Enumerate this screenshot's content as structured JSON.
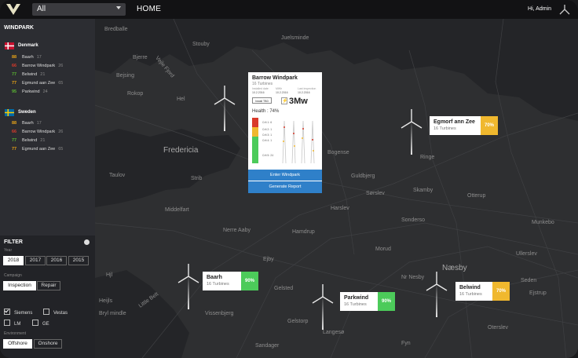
{
  "topbar": {
    "select_value": "All",
    "home_label": "HOME",
    "user_label": "Hi, Admin"
  },
  "sidebar": {
    "title": "WINDPARK",
    "countries": [
      {
        "name": "Denmark",
        "parks": [
          {
            "score": "88",
            "name": "Baarh",
            "count": "17",
            "color": "#e8a317"
          },
          {
            "score": "66",
            "name": "Barrow Windpark",
            "count": "26",
            "color": "#d93a2b"
          },
          {
            "score": "77",
            "name": "Belwind",
            "count": "21",
            "color": "#5bb832"
          },
          {
            "score": "77",
            "name": "Egmund aan Zee",
            "count": "65",
            "color": "#e8a317"
          },
          {
            "score": "95",
            "name": "Parkwind",
            "count": "24",
            "color": "#5bb832"
          }
        ]
      },
      {
        "name": "Sweden",
        "parks": [
          {
            "score": "88",
            "name": "Baarh",
            "count": "17",
            "color": "#e8a317"
          },
          {
            "score": "66",
            "name": "Barrow Windpark",
            "count": "26",
            "color": "#d93a2b"
          },
          {
            "score": "77",
            "name": "Belwind",
            "count": "21",
            "color": "#5bb832"
          },
          {
            "score": "77",
            "name": "Egmund aan Zee",
            "count": "65",
            "color": "#e8a317"
          }
        ]
      }
    ]
  },
  "filter": {
    "title": "FILTER",
    "year_label": "Year",
    "years": [
      "2018",
      "2017",
      "2016",
      "2015"
    ],
    "campaign_label": "Campaign",
    "campaigns": [
      "Inspection",
      "Repair"
    ],
    "makers": [
      {
        "label": "Siemens",
        "checked": true
      },
      {
        "label": "Vestas",
        "checked": false
      },
      {
        "label": "LM",
        "checked": false
      },
      {
        "label": "GE",
        "checked": false
      }
    ],
    "environment_label": "Environment",
    "environments": [
      "Offshore",
      "Onshore"
    ]
  },
  "map": {
    "cities": [
      {
        "name": "Bredballe",
        "big": false
      },
      {
        "name": "Stouby",
        "big": false
      },
      {
        "name": "Juelsminde",
        "big": false
      },
      {
        "name": "Bjerre",
        "big": false
      },
      {
        "name": "Vejle Fjord",
        "big": false
      },
      {
        "name": "Bejsing",
        "big": false
      },
      {
        "name": "Rokop",
        "big": false
      },
      {
        "name": "Hel",
        "big": false
      },
      {
        "name": "Fredericia",
        "big": true
      },
      {
        "name": "Taulov",
        "big": false
      },
      {
        "name": "Strib",
        "big": false
      },
      {
        "name": "Middelfart",
        "big": false
      },
      {
        "name": "Nerre Aaby",
        "big": false
      },
      {
        "name": "Hamdrup",
        "big": false
      },
      {
        "name": "Harslev",
        "big": false
      },
      {
        "name": "Sørslev",
        "big": false
      },
      {
        "name": "Skamby",
        "big": false
      },
      {
        "name": "Otterup",
        "big": false
      },
      {
        "name": "Bogense",
        "big": false
      },
      {
        "name": "Guldbjerg",
        "big": false
      },
      {
        "name": "Ringe",
        "big": false
      },
      {
        "name": "Sonderso",
        "big": false
      },
      {
        "name": "Morud",
        "big": false
      },
      {
        "name": "Ejby",
        "big": false
      },
      {
        "name": "Gelsted",
        "big": false
      },
      {
        "name": "Nr Nesby",
        "big": false
      },
      {
        "name": "Næsby",
        "big": true
      },
      {
        "name": "Heijls",
        "big": false
      },
      {
        "name": "Hjl",
        "big": false
      },
      {
        "name": "Little Belt",
        "big": false
      },
      {
        "name": "Bryl mindle",
        "big": false
      },
      {
        "name": "Sandager",
        "big": false
      },
      {
        "name": "Fyn",
        "big": false
      },
      {
        "name": "Vissenbjerg",
        "big": false
      },
      {
        "name": "Gelstorp",
        "big": false
      },
      {
        "name": "Langesø",
        "big": false
      },
      {
        "name": "Oterslev",
        "big": false
      },
      {
        "name": "Munkebo",
        "big": false
      },
      {
        "name": "Ullerslev",
        "big": false
      },
      {
        "name": "Seden",
        "big": false
      },
      {
        "name": "Ejstrup",
        "big": false
      }
    ],
    "cards": [
      {
        "title": "Egmorf ann Zee",
        "sub": "16 Turbines",
        "pct": "70%",
        "color": "#f0b82e"
      },
      {
        "title": "Baarh",
        "sub": "16 Turbines",
        "pct": "90%",
        "color": "#4ccb5a"
      },
      {
        "title": "Parkwind",
        "sub": "16 Turbines",
        "pct": "90%",
        "color": "#4ccb5a"
      },
      {
        "title": "Belwind",
        "sub": "16 Turbines",
        "pct": "70%",
        "color": "#f0b82e"
      }
    ]
  },
  "popup": {
    "title": "Barrow Windpark",
    "sub": "16 Turbines",
    "meta": [
      {
        "k": "Installed date",
        "v": "10.2.2016"
      },
      {
        "k": "MWh",
        "v": "10.2.2016"
      },
      {
        "k": "Last inspection",
        "v": "10.2.2016"
      }
    ],
    "inst_btn": "Install TBD",
    "mw": "3Mw",
    "health": "Health : 74%",
    "ctrl_labels": [
      "Crit 1: 6",
      "Crit 2: 1",
      "Crit 3: 1",
      "Crit 4: 1",
      "Crit 5: 24"
    ],
    "enter": "Enter Windpark",
    "report": "Generate Report"
  }
}
